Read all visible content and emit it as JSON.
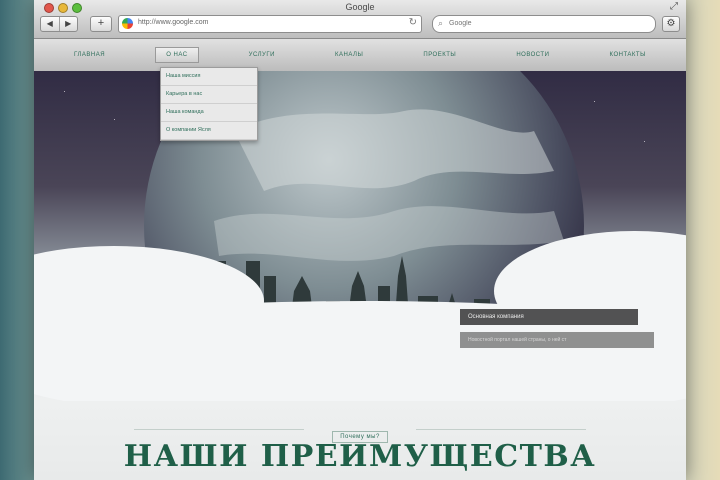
{
  "browser": {
    "window_title": "Google",
    "nav_back": "◀",
    "nav_forward": "▶",
    "add_tab": "+",
    "url": "http://www.google.com",
    "reload_glyph": "↻",
    "search_placeholder": "Google",
    "search_icon": "magnifier-icon",
    "settings_glyph": "⚙"
  },
  "site": {
    "nav": [
      {
        "label": "Главная"
      },
      {
        "label": "О нас"
      },
      {
        "label": "Услуги"
      },
      {
        "label": "Каналы"
      },
      {
        "label": "Проекты"
      },
      {
        "label": "Новости"
      },
      {
        "label": "Контакты"
      }
    ],
    "dropdown": [
      {
        "label": "Наша миссия"
      },
      {
        "label": "Карьера в нас"
      },
      {
        "label": "Наша команда"
      },
      {
        "label": "О компании Ясля"
      }
    ],
    "hero_caption": {
      "title": "Основная компания",
      "subtitle": "Новостной портал нашей страны, о ней ст"
    },
    "section_label": "Почему мы?",
    "section_heading": "НАШИ ПРЕИМУЩЕСТВА"
  },
  "colors": {
    "brand_green": "#1f5f48",
    "nav_text": "#2e6e5a"
  }
}
